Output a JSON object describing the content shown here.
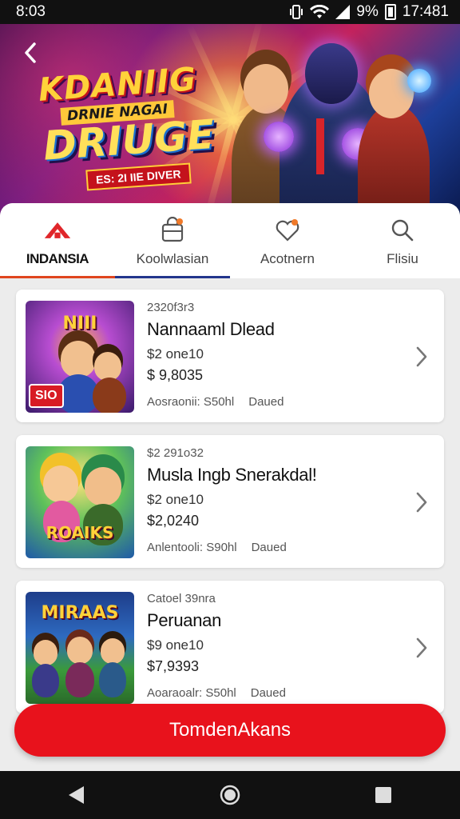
{
  "status_bar": {
    "time": "8:03",
    "battery_text": "9%",
    "clock_right": "17:481"
  },
  "banner": {
    "logo_line1": "KDANIIG",
    "logo_line2": "DRNIE NAGAI",
    "logo_line3": "DRIUGE",
    "logo_line4": "ES: 2I IIE DIVER",
    "colors": {
      "primary": "#ffd23a",
      "accent": "#c4121c"
    }
  },
  "tabs": [
    {
      "label": "INDANSIA",
      "icon": "home-icon",
      "active": true,
      "indicator_color": "#e0451e"
    },
    {
      "label": "Koolwlasian",
      "icon": "bag-icon",
      "active": false,
      "indicator_color": "#22358c"
    },
    {
      "label": "Acotnern",
      "icon": "heart-icon",
      "active": false
    },
    {
      "label": "Flisiu",
      "icon": "search-icon",
      "active": false
    }
  ],
  "items": [
    {
      "code": "2320f3r3",
      "name": "Nannaaml Dlead",
      "line": "$2 one10",
      "price": "$ 9,8035",
      "meta1": "Aosraonii:  S50hl",
      "meta2": "Daued",
      "thumb_title": "NIII",
      "tag": "SIO"
    },
    {
      "code": "$2 291o32",
      "name": "Musla Ingb Snerakdal!",
      "line": "$2 one10",
      "price": "$2,0240",
      "meta1": "Anlentooli:  S90hl",
      "meta2": "Daued",
      "thumb_title": "ROAIKS",
      "tag": ""
    },
    {
      "code": "Catoel 39nra",
      "name": "Peruanan",
      "line": "$9 one10",
      "price": "$7,9393",
      "meta1": "Aoaraoalr:  S50hl",
      "meta2": "Daued",
      "thumb_title": "MIRAAS",
      "tag": ""
    }
  ],
  "cta": {
    "label": "TomdenAkans",
    "color": "#e8121c"
  },
  "nav": {
    "back_icon": "triangle-back-icon",
    "home_icon": "circle-home-icon",
    "recents_icon": "square-recents-icon"
  }
}
